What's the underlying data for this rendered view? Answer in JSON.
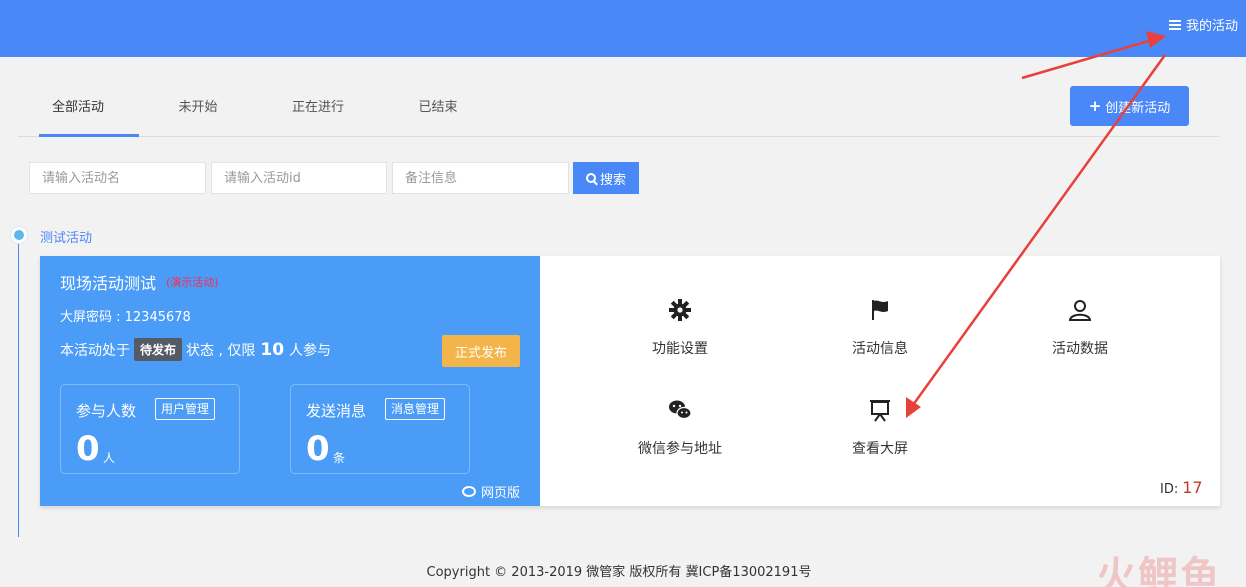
{
  "header": {
    "menu_label": "我的活动"
  },
  "tabs": [
    {
      "label": "全部活动",
      "active": true
    },
    {
      "label": "未开始"
    },
    {
      "label": "正在进行"
    },
    {
      "label": "已结束"
    }
  ],
  "create_button": "创建新活动",
  "search": {
    "name_placeholder": "请输入活动名",
    "id_placeholder": "请输入活动id",
    "note_placeholder": "备注信息",
    "button_label": "搜索"
  },
  "timeline": {
    "group_label": "测试活动"
  },
  "activity": {
    "title": "现场活动测试",
    "demo_tag": "(演示活动)",
    "screen_password": "大屏密码 : 12345678",
    "status_prefix": "本活动处于",
    "status_badge": "待发布",
    "status_middle": "状态 , 仅限",
    "limit": "10",
    "status_suffix": "人参与",
    "publish_button": "正式发布",
    "participants": {
      "label": "参与人数",
      "manage": "用户管理",
      "value": "0",
      "unit": "人"
    },
    "messages": {
      "label": "发送消息",
      "manage": "消息管理",
      "value": "0",
      "unit": "条"
    },
    "web_version": "网页版",
    "functions": [
      {
        "label": "功能设置",
        "icon": "gear-icon"
      },
      {
        "label": "活动信息",
        "icon": "flag-icon"
      },
      {
        "label": "活动数据",
        "icon": "user-icon"
      },
      {
        "label": "微信参与地址",
        "icon": "wechat-icon"
      },
      {
        "label": "查看大屏",
        "icon": "presentation-screen-icon"
      }
    ],
    "id_label": "ID:",
    "id_value": "17"
  },
  "footer": "Copyright © 2013-2019 微管家 版权所有 冀ICP备13002191号",
  "watermark": "火鲤鱼",
  "colors": {
    "primary": "#4a88f7",
    "card_blue": "#4a9cf7",
    "publish": "#f3b449",
    "annotation": "#e8413c"
  }
}
